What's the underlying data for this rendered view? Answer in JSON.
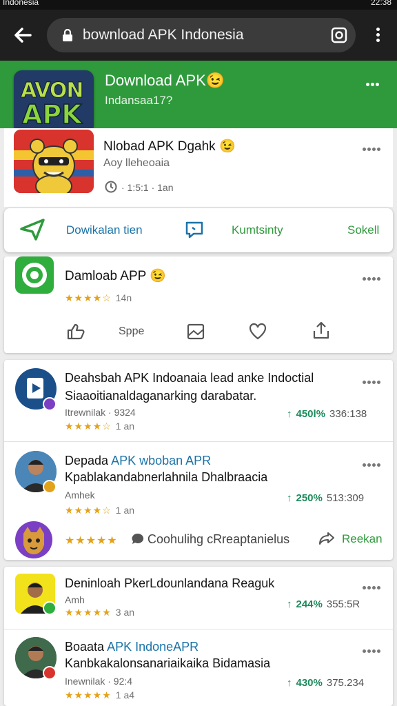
{
  "status_bar": {
    "left_text": "Indonesia",
    "right_text": "22:38"
  },
  "browser": {
    "url": "bownload APK Indonesia"
  },
  "app_header": {
    "title": "Download APK😉",
    "subtitle": "Indansaa17?",
    "logo_text_1": "AVON",
    "logo_text_2": "APK"
  },
  "top_app": {
    "title": "Nlobad APK Dgahk 😉",
    "subtitle": "Aoy lleheoaia",
    "meta": "· 1:5:1 · 1an"
  },
  "actions": {
    "download": "Dowikalan tien",
    "community": "Kumtsinty",
    "sell": "Sokell"
  },
  "app2": {
    "title": "Damloab APP 😉",
    "stars": "★★★★☆",
    "age": "14n",
    "share_label": "Sppe"
  },
  "list1": [
    {
      "title": "Deahsbah APK Indoanaia lead anke Indoctial",
      "line2": "Siaaoitianaldaganarking darabatar.",
      "meta": "Itrewnilak · 9324",
      "stars": "★★★★☆",
      "age": "1 an",
      "pct": "450l%",
      "count": "336:138"
    },
    {
      "title_a": "Depada ",
      "title_b": "APK wboban APR",
      "line2": "Kpablakandabnerlahnila Dhalbraacia",
      "meta": "Amhek",
      "stars": "★★★★☆",
      "age": "1 an",
      "pct": "250%",
      "count": "513:309"
    }
  ],
  "comment_row": {
    "stars": "★★★★★",
    "text": "Coohulihg cRreaptanielus",
    "action": "Reekan"
  },
  "list2": [
    {
      "title": "Deninloah PkerLdounlandana Reaguk",
      "meta": "Amh",
      "stars": "★★★★★",
      "age": "3 an",
      "pct": "244%",
      "count": "355:5R"
    },
    {
      "title_a": "Boaata ",
      "title_b": "APK IndoneAPR",
      "line2": "Kanbkakalonsanariaikaika Bidamasia",
      "meta": "Inewnilak · 92:4",
      "stars": "★★★★★",
      "age": "1 a4",
      "pct": "430%",
      "count": "375.234"
    }
  ],
  "colors": {
    "header_green": "#2e9a3c",
    "accent_blue": "#1a73a8",
    "accent_green": "#1b8a5a",
    "star": "#e3a21a"
  }
}
